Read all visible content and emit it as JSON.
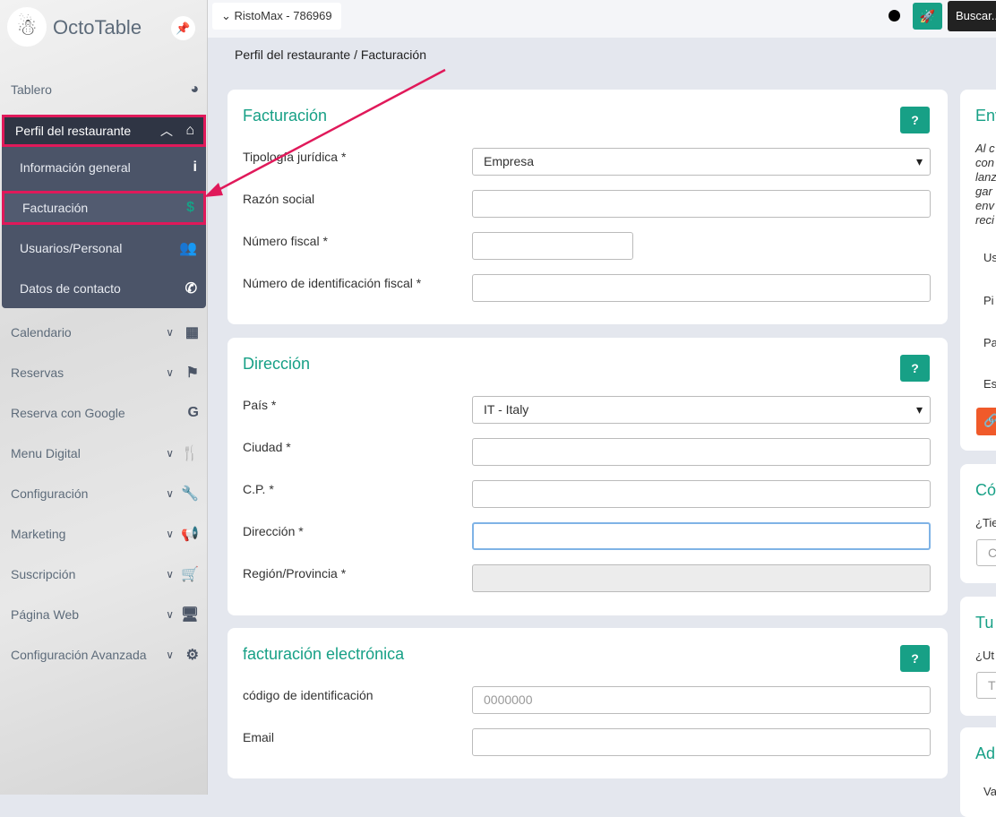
{
  "sidebar": {
    "brand": "OctoTable",
    "items": [
      {
        "label": "Tablero"
      },
      {
        "label": "Perfil del restaurante"
      },
      {
        "label": "Información general"
      },
      {
        "label": "Facturación"
      },
      {
        "label": "Usuarios/Personal"
      },
      {
        "label": "Datos de contacto"
      },
      {
        "label": "Calendario"
      },
      {
        "label": "Reservas"
      },
      {
        "label": "Reserva con Google"
      },
      {
        "label": "Menu Digital"
      },
      {
        "label": "Configuración"
      },
      {
        "label": "Marketing"
      },
      {
        "label": "Suscripción"
      },
      {
        "label": "Página Web"
      },
      {
        "label": "Configuración Avanzada"
      }
    ]
  },
  "topbar": {
    "restaurant": "RistoMax - 786969",
    "search": "Buscar..."
  },
  "breadcrumb": "Perfil del restaurante / Facturación",
  "billing": {
    "title": "Facturación",
    "help": "?",
    "fields": [
      {
        "label": "Tipología jurídica *",
        "value": "Empresa"
      },
      {
        "label": "Razón social",
        "value": ""
      },
      {
        "label": "Número fiscal *",
        "value": ""
      },
      {
        "label": "Número de identificación fiscal *",
        "value": ""
      }
    ]
  },
  "address": {
    "title": "Dirección",
    "help": "?",
    "fields": [
      {
        "label": "País *",
        "value": "IT - Italy"
      },
      {
        "label": "Ciudad *",
        "value": ""
      },
      {
        "label": "C.P. *",
        "value": ""
      },
      {
        "label": "Dirección *",
        "value": ""
      },
      {
        "label": "Región/Provincia *",
        "value": ""
      }
    ]
  },
  "einvoice": {
    "title": "facturación electrónica",
    "help": "?",
    "fields": [
      {
        "label": "código de identificación",
        "placeholder": "0000000"
      },
      {
        "label": "Email",
        "value": ""
      }
    ]
  },
  "right": {
    "c1": {
      "title": "Env",
      "lines": [
        "Al c",
        "con",
        "lanz",
        "gar",
        "env",
        "reci"
      ],
      "rows": [
        "Us",
        "Pi",
        "Pa",
        "Es"
      ]
    },
    "c2": {
      "title": "Có",
      "q": "¿Tie",
      "ph": "C"
    },
    "c3": {
      "title": "Tu",
      "q": "¿Ut",
      "ph": "T"
    },
    "c4": {
      "title": "Ad",
      "q": "Va"
    }
  }
}
